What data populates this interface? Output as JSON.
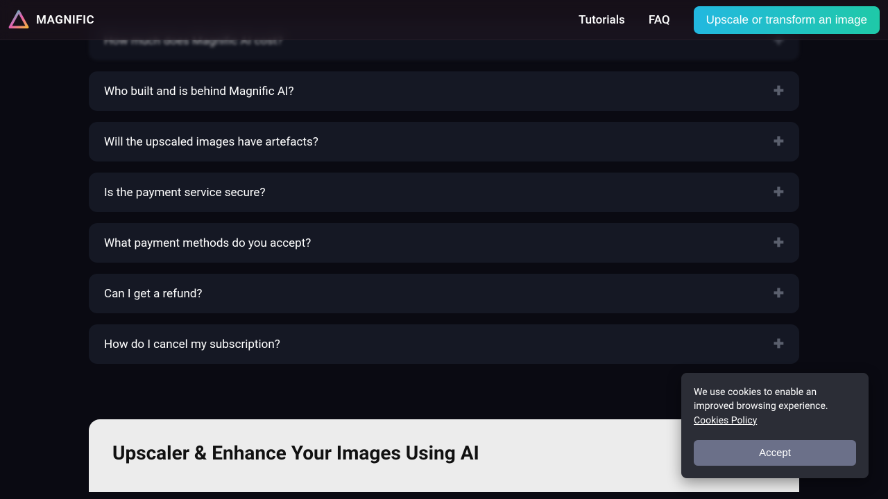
{
  "header": {
    "brand": "MAGNIFIC",
    "nav": {
      "tutorials": "Tutorials",
      "faq": "FAQ"
    },
    "cta": "Upscale or transform an image"
  },
  "faq": {
    "items": [
      {
        "q": "How much does Magnific AI cost?"
      },
      {
        "q": "Who built and is behind Magnific AI?"
      },
      {
        "q": "Will the upscaled images have artefacts?"
      },
      {
        "q": "Is the payment service secure?"
      },
      {
        "q": "What payment methods do you accept?"
      },
      {
        "q": "Can I get a refund?"
      },
      {
        "q": "How do I cancel my subscription?"
      }
    ]
  },
  "article": {
    "title": "Upscaler & Enhance Your Images Using AI"
  },
  "cookies": {
    "text_a": "We use cookies to enable an improved browsing experience. ",
    "policy": "Cookies Policy",
    "accept": "Accept"
  }
}
